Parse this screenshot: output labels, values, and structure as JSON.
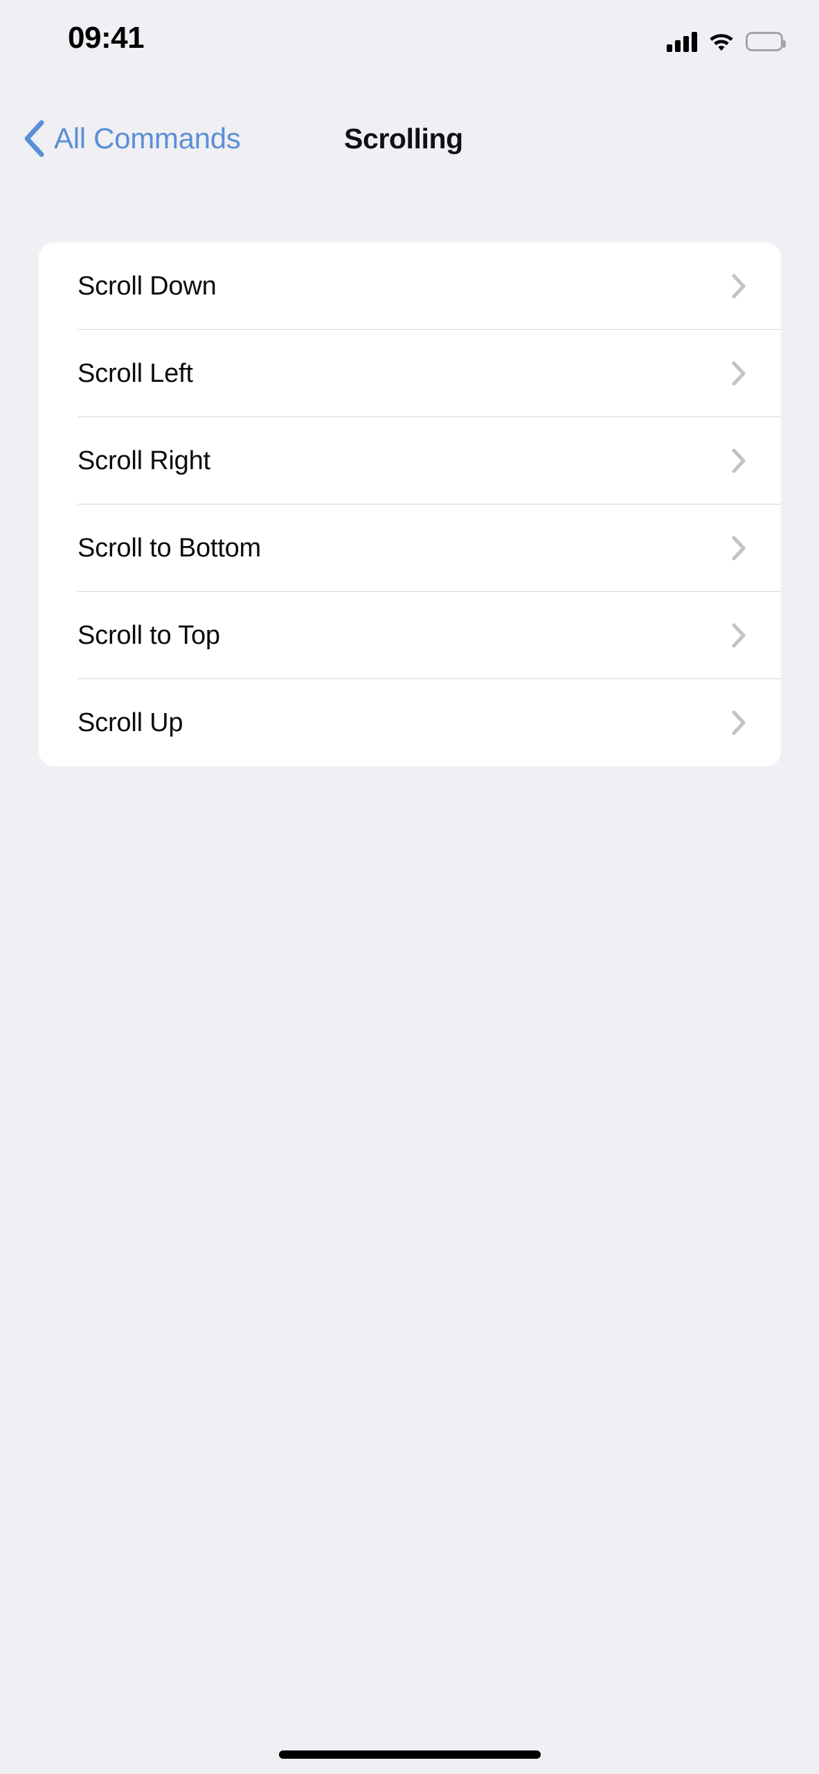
{
  "status_bar": {
    "time": "09:41",
    "cellular_icon": "cellular-signal-icon",
    "cellular_bars_filled": 4,
    "wifi_icon": "wifi-icon",
    "battery_icon": "battery-full-icon",
    "battery_level_percent": 100
  },
  "nav": {
    "back_icon": "chevron-left-icon",
    "back_label": "All Commands",
    "title": "Scrolling",
    "back_color": "#5a8fd6",
    "title_color": "#111114"
  },
  "list": {
    "rows": [
      {
        "label": "Scroll Down",
        "accessory_icon": "chevron-right-icon"
      },
      {
        "label": "Scroll Left",
        "accessory_icon": "chevron-right-icon"
      },
      {
        "label": "Scroll Right",
        "accessory_icon": "chevron-right-icon"
      },
      {
        "label": "Scroll to Bottom",
        "accessory_icon": "chevron-right-icon"
      },
      {
        "label": "Scroll to Top",
        "accessory_icon": "chevron-right-icon"
      },
      {
        "label": "Scroll Up",
        "accessory_icon": "chevron-right-icon"
      }
    ]
  },
  "home_indicator": {
    "icon": "home-indicator-bar"
  },
  "colors": {
    "background": "#f0eff4",
    "card": "#ffffff",
    "separator": "#d6d5da",
    "accent_blue": "#5a8fd6",
    "chevron_gray": "#c2c2c7"
  }
}
